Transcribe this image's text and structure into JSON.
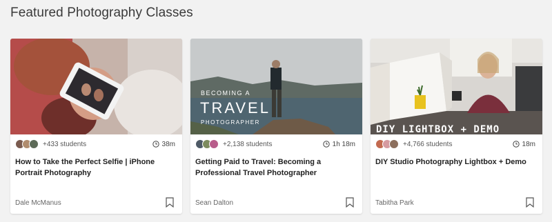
{
  "section": {
    "title": "Featured Photography Classes"
  },
  "cards": [
    {
      "students": "+433 students",
      "duration": "38m",
      "title": "How to Take the Perfect Selfie | iPhone Portrait Photography",
      "author": "Dale McManus",
      "thumb_overlay": ""
    },
    {
      "students": "+2,138 students",
      "duration": "1h 18m",
      "title": "Getting Paid to Travel: Becoming a Professional Travel Photographer",
      "author": "Sean Dalton",
      "thumb_overlay": {
        "line1": "BECOMING A",
        "line2": "TRAVEL",
        "line3": "PHOTOGRAPHER"
      }
    },
    {
      "students": "+4,766 students",
      "duration": "18m",
      "title": "DIY Studio Photography Lightbox + Demo",
      "author": "Tabitha Park",
      "thumb_overlay": {
        "line1": "DIY LIGHTBOX + DEMO"
      }
    }
  ],
  "icons": {
    "clock": "clock-icon",
    "bookmark": "bookmark-icon"
  },
  "colors": {
    "page_bg": "#f2f2f2",
    "card_bg": "#ffffff",
    "text_dark": "#222222",
    "text_muted": "#666666"
  }
}
